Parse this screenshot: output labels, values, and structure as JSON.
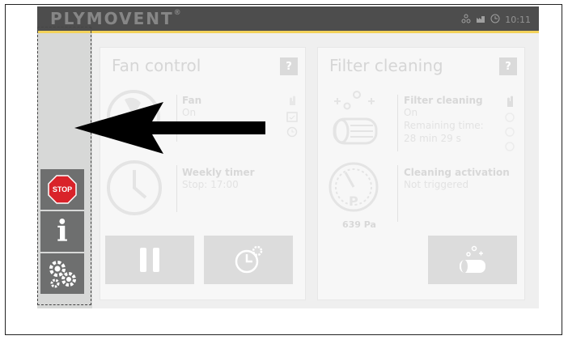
{
  "header": {
    "logo_text": "PLYMOVENT",
    "logo_mark": "®",
    "time": "10:11"
  },
  "sidebar": {
    "stop_label": "STOP",
    "info_label": "i"
  },
  "fan_panel": {
    "title": "Fan control",
    "help": "?",
    "fan_label": "Fan",
    "fan_value": "On",
    "timer_label": "Weekly timer",
    "timer_value": "Stop: 17:00"
  },
  "filter_panel": {
    "title": "Filter cleaning",
    "help": "?",
    "cleaning_label": "Filter cleaning",
    "cleaning_value": "On",
    "remaining_label": "Remaining time:",
    "remaining_value": "28 min 29 s",
    "activation_label": "Cleaning activation",
    "activation_value": "Not triggered",
    "pressure": "639 Pa",
    "gauge_letter": "P"
  },
  "colors": {
    "topbar": "#4d4d4d",
    "accent": "#f3d25a",
    "sidebar": "#d7d8d7",
    "sidebar_button": "#6e6f6f",
    "stop_red": "#d9232a"
  }
}
